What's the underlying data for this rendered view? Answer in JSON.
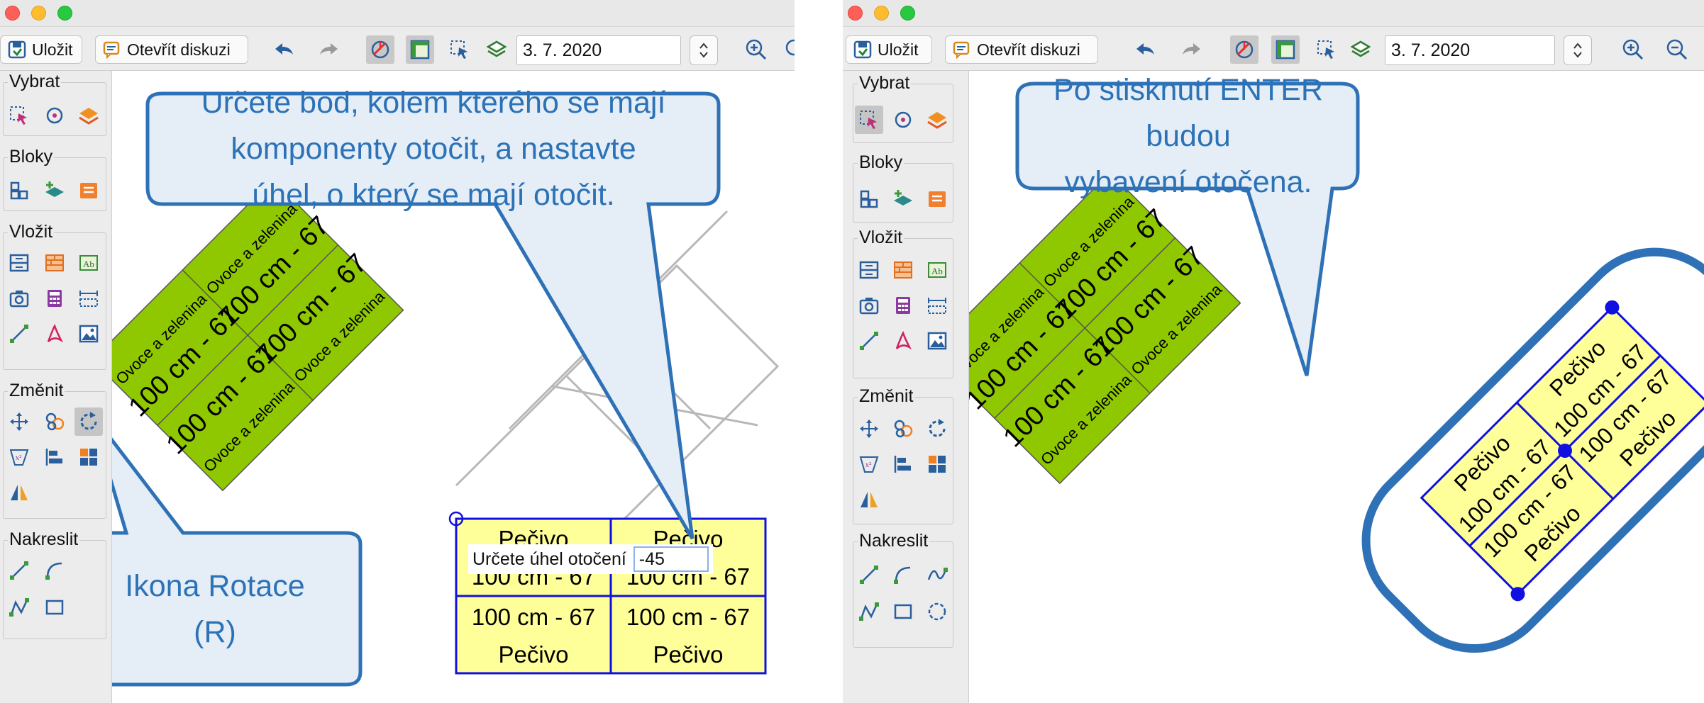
{
  "toolbar": {
    "save_label": "Uložit",
    "discuss_label": "Otevřít diskuzi",
    "date_value": "3. 7. 2020"
  },
  "sidebar": {
    "groups": {
      "select": "Vybrat",
      "blocks": "Bloky",
      "insert": "Vložit",
      "change": "Změnit",
      "draw": "Nakreslit"
    }
  },
  "left_panel": {
    "callout_main_lines": [
      "Určete bod, kolem kterého se mají",
      "komponenty otočit, a nastavte",
      "úhel, o který se mají otočit."
    ],
    "callout_icon_lines": [
      "Ikona Rotace",
      "(R)"
    ],
    "angle_prompt_label": "Určete úhel otočení",
    "angle_prompt_value": "-45"
  },
  "right_panel": {
    "callout_lines": [
      "Po stisknutí ENTER budou",
      "vybavení otočena."
    ]
  },
  "shelves": {
    "green_labels": {
      "produce": "Ovoce a zelenina",
      "size": "100 cm - 67"
    },
    "yellow_labels": {
      "bakery": "Pečivo",
      "size": "100 cm - 67"
    }
  },
  "colors": {
    "callout_fill": "#e5eef6",
    "callout_border": "#2f71b6",
    "callout_text": "#2c72b7",
    "green_shelf": "#8fc800",
    "yellow_shelf": "#ffff99",
    "selection_blue": "#1010e0"
  }
}
